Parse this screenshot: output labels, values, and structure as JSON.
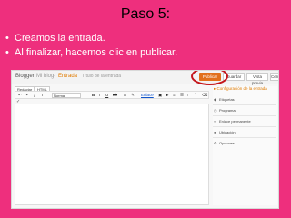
{
  "slide": {
    "title": "Paso 5:",
    "bullets": [
      "Creamos la entrada.",
      "Al finalizar, hacemos clic en publicar."
    ],
    "bullet_symbol": "•"
  },
  "app": {
    "brand": "Blogger",
    "blog_name": "Mi blog",
    "separator": "·",
    "section": "Entrada",
    "post_title_placeholder": "Título de la entrada",
    "buttons": {
      "publish": "Publicar",
      "save": "Guardar",
      "preview": "Vista previa",
      "close": "Cerrar"
    },
    "modes": [
      "Redactar",
      "HTML"
    ],
    "toolbar": {
      "font": "Normal",
      "bold": "B",
      "italic": "I",
      "underline": "U",
      "link": "Enlace"
    },
    "sidebar": {
      "title": "▸ Configuración de la entrada",
      "items": [
        "Etiquetas",
        "Programar",
        "Enlace permanente",
        "Ubicación",
        "Opciones"
      ]
    }
  },
  "colors": {
    "slide_bg": "#ee2f7d",
    "publish": "#e2701c",
    "highlight_circle": "#c4161c"
  }
}
